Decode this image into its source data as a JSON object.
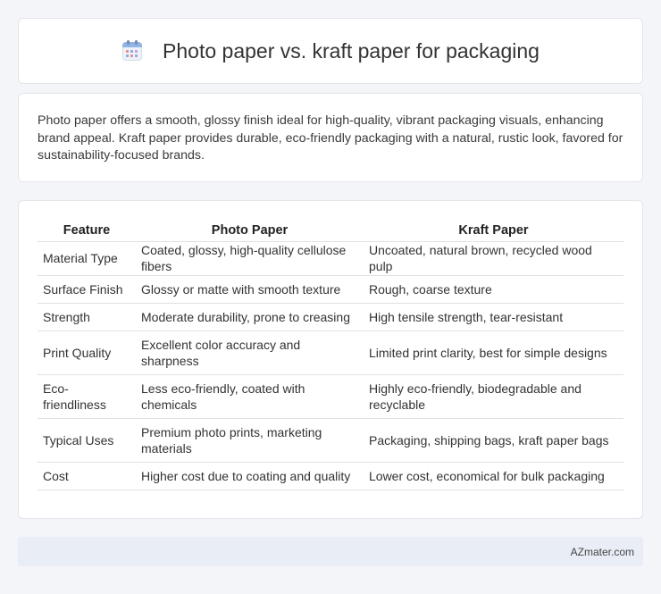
{
  "header": {
    "title": "Photo paper vs. kraft paper for packaging",
    "icon": "calendar-icon"
  },
  "summary": {
    "text": "Photo paper offers a smooth, glossy finish ideal for high-quality, vibrant packaging visuals, enhancing brand appeal. Kraft paper provides durable, eco-friendly packaging with a natural, rustic look, favored for sustainability-focused brands."
  },
  "table": {
    "headers": [
      "Feature",
      "Photo Paper",
      "Kraft Paper"
    ],
    "rows": [
      [
        "Material Type",
        "Coated, glossy, high-quality cellulose fibers",
        "Uncoated, natural brown, recycled wood pulp"
      ],
      [
        "Surface Finish",
        "Glossy or matte with smooth texture",
        "Rough, coarse texture"
      ],
      [
        "Strength",
        "Moderate durability, prone to creasing",
        "High tensile strength, tear-resistant"
      ],
      [
        "Print Quality",
        "Excellent color accuracy and sharpness",
        "Limited print clarity, best for simple designs"
      ],
      [
        "Eco-friendliness",
        "Less eco-friendly, coated with chemicals",
        "Highly eco-friendly, biodegradable and recyclable"
      ],
      [
        "Typical Uses",
        "Premium photo prints, marketing materials",
        "Packaging, shipping bags, kraft paper bags"
      ],
      [
        "Cost",
        "Higher cost due to coating and quality",
        "Lower cost, economical for bulk packaging"
      ]
    ]
  },
  "footer": {
    "brand": "AZmater.com"
  },
  "colors": {
    "background": "#f4f5f8",
    "card": "#ffffff",
    "footer": "#e9eef6",
    "icon_accent": "#8fb4e8"
  }
}
